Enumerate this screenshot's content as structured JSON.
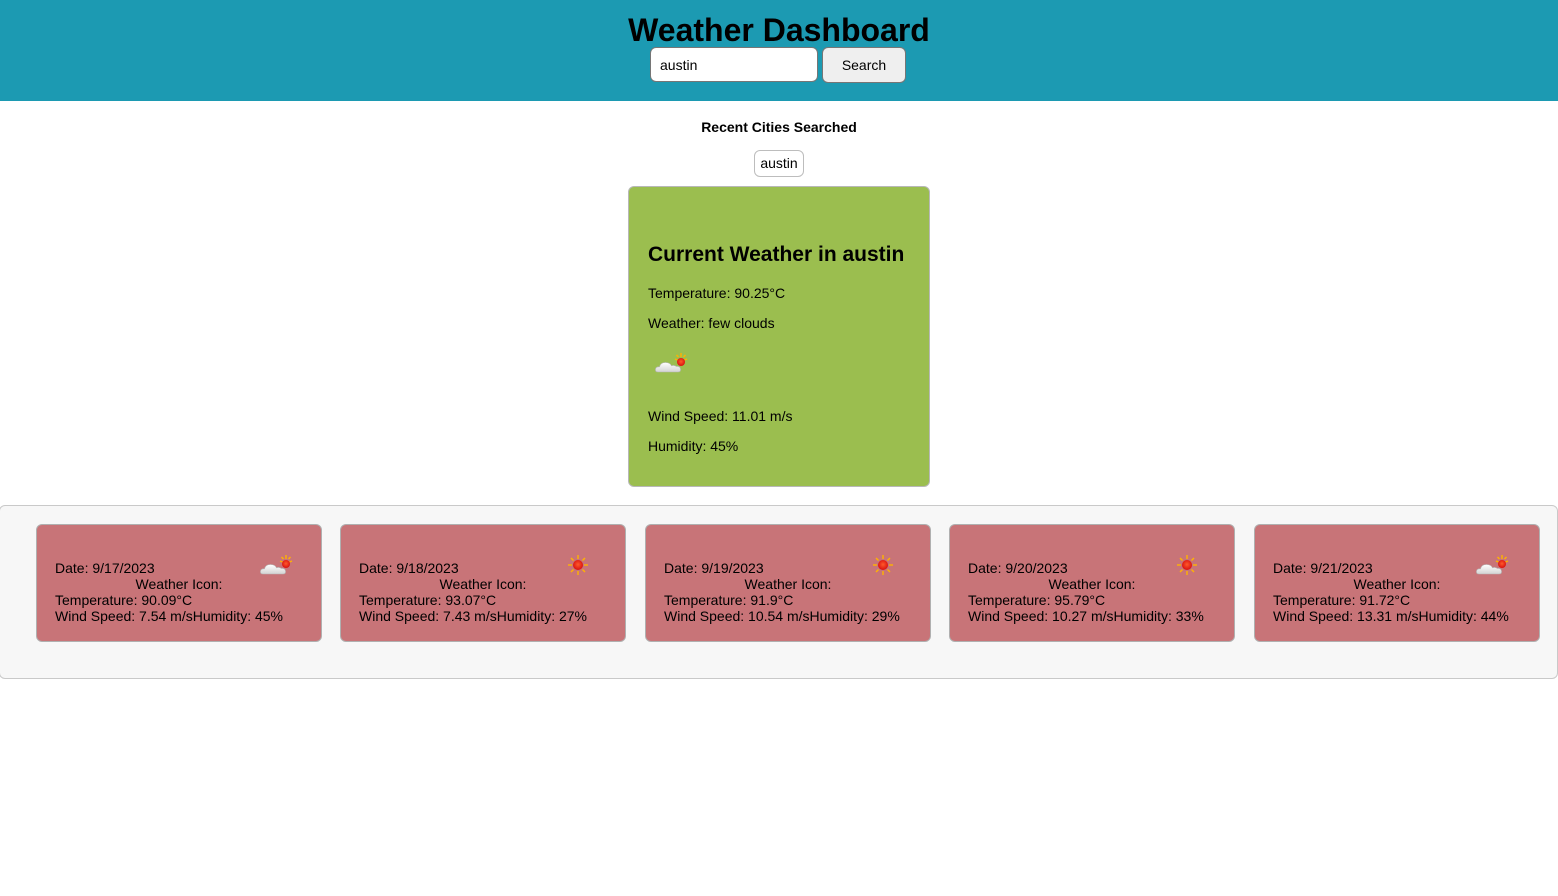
{
  "header": {
    "title": "Weather Dashboard",
    "search_value": "austin",
    "search_button": "Search",
    "background_color": "#1c9ab2"
  },
  "recent": {
    "title": "Recent Cities Searched",
    "cities": [
      "austin"
    ]
  },
  "current": {
    "title": "Current Weather in austin",
    "temperature": "Temperature: 90.25°C",
    "weather": "Weather: few clouds",
    "icon": "few-clouds-icon",
    "wind": "Wind Speed: 11.01 m/s",
    "humidity": "Humidity: 45%",
    "background_color": "#9bbe4f"
  },
  "forecast": {
    "background_color": "#c87478",
    "days": [
      {
        "date": "Date: 9/17/2023",
        "icon_label": "Weather Icon:",
        "icon": "few-clouds-icon",
        "temperature": "Temperature: 90.09°C",
        "wind_humidity": "Wind Speed: 7.54 m/sHumidity: 45%"
      },
      {
        "date": "Date: 9/18/2023",
        "icon_label": "Weather Icon:",
        "icon": "clear-sky-icon",
        "temperature": "Temperature: 93.07°C",
        "wind_humidity": "Wind Speed: 7.43 m/sHumidity: 27%"
      },
      {
        "date": "Date: 9/19/2023",
        "icon_label": "Weather Icon:",
        "icon": "clear-sky-icon",
        "temperature": "Temperature: 91.9°C",
        "wind_humidity": "Wind Speed: 10.54 m/sHumidity: 29%"
      },
      {
        "date": "Date: 9/20/2023",
        "icon_label": "Weather Icon:",
        "icon": "clear-sky-icon",
        "temperature": "Temperature: 95.79°C",
        "wind_humidity": "Wind Speed: 10.27 m/sHumidity: 33%"
      },
      {
        "date": "Date: 9/21/2023",
        "icon_label": "Weather Icon:",
        "icon": "few-clouds-icon",
        "temperature": "Temperature: 91.72°C",
        "wind_humidity": "Wind Speed: 13.31 m/sHumidity: 44%"
      }
    ]
  }
}
